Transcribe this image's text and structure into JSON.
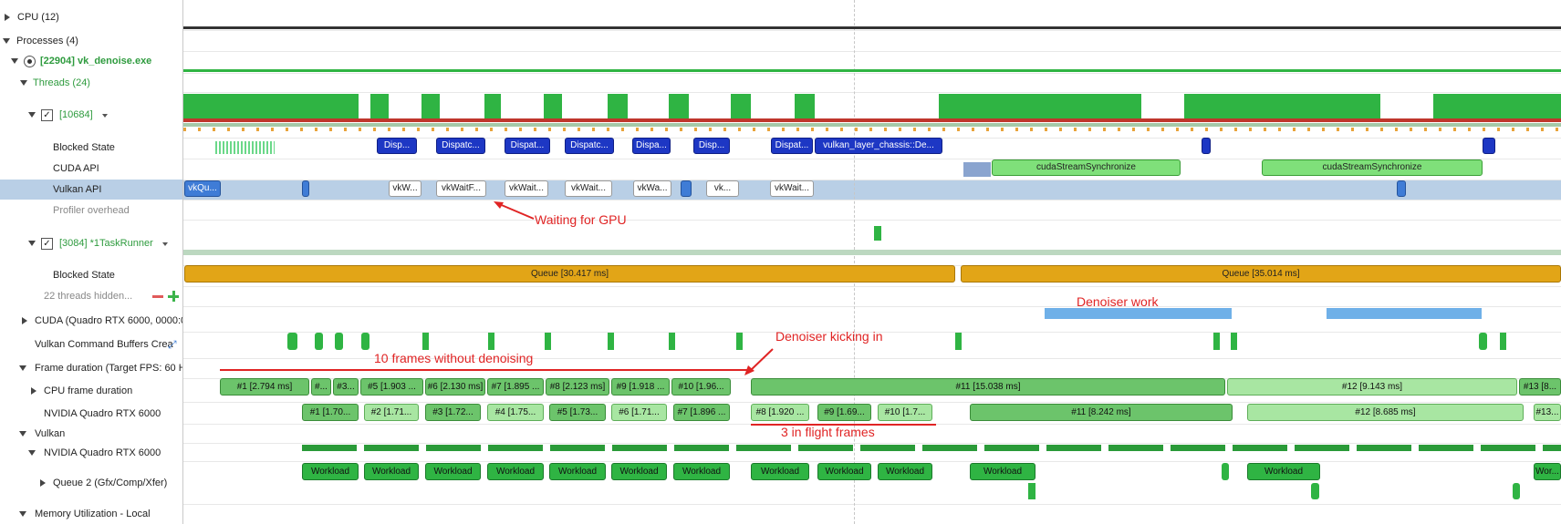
{
  "tree": {
    "cpu": "CPU (12)",
    "processes": "Processes (4)",
    "process": "[22904] vk_denoise.exe",
    "threads": "Threads (24)",
    "thread_main": "[10684]",
    "blocked_state": "Blocked State",
    "cuda_api": "CUDA API",
    "vulkan_api": "Vulkan API",
    "profiler_overhead": "Profiler overhead",
    "thread_task": "[3084] *1TaskRunner",
    "blocked_state_2": "Blocked State",
    "threads_hidden": "22 threads hidden...",
    "cuda_device": "CUDA (Quadro RTX 6000, 0000:0",
    "vk_cmd_buffers": "Vulkan Command Buffers Crea",
    "frame_duration": "Frame duration (Target FPS: 60 H",
    "cpu_frame": "CPU frame duration",
    "gpu_frame": "NVIDIA Quadro RTX 6000",
    "vulkan": "Vulkan",
    "vulkan_gpu": "NVIDIA Quadro RTX 6000",
    "queue2": "Queue 2 (Gfx/Comp/Xfer)",
    "memory": "Memory Utilization - Local"
  },
  "dispatch_labels": [
    "Disp...",
    "Dispatc...",
    "Dispat...",
    "Dispatc...",
    "Dispa...",
    "Disp...",
    "Dispat...",
    "vulkan_layer_chassis::De..."
  ],
  "vk_labels": [
    "vkQu...",
    "vkW...",
    "vkWaitF...",
    "vkWait...",
    "vkWait...",
    "vkWa...",
    "vk...",
    "vkWait..."
  ],
  "cuda_labels": [
    "cudaStreamSynchronize",
    "cudaStreamSynchronize"
  ],
  "queue_labels": [
    "Queue [30.417 ms]",
    "Queue [35.014 ms]"
  ],
  "cpu_frames": [
    "#1 [2.794 ms]",
    "#...",
    "#3...",
    "#5 [1.903 ...",
    "#6 [2.130 ms]",
    "#7 [1.895 ...",
    "#8 [2.123 ms]",
    "#9 [1.918 ...",
    "#10 [1.96...",
    "#11 [15.038 ms]",
    "#12 [9.143 ms]",
    "#13 [8..."
  ],
  "gpu_frames": [
    "#1 [1.70...",
    "#2 [1.71...",
    "#3 [1.72...",
    "#4 [1.75...",
    "#5 [1.73...",
    "#6 [1.71...",
    "#7 [1.896 ...",
    "#8 [1.920 ...",
    "#9 [1.69...",
    "#10 [1.7...",
    "#11 [8.242 ms]",
    "#12 [8.685 ms]",
    "#13..."
  ],
  "workload_labels": [
    "Workload",
    "Workload",
    "Workload",
    "Workload",
    "Workload",
    "Workload",
    "Workload",
    "Workload",
    "Workload",
    "Workload",
    "Workload",
    "Workload",
    "Wor..."
  ],
  "annotations": {
    "waiting": "Waiting for GPU",
    "denoiser_work": "Denoiser work",
    "denoiser_kicking": "Denoiser kicking in",
    "ten_frames": "10 frames without denoising",
    "in_flight": "3 in flight frames"
  },
  "colors": {
    "annotation": "#e02424",
    "dispatch": "#1d37c4",
    "queue": "#e2a517",
    "workload": "#2fb443",
    "selection": "#b9cfe6"
  }
}
